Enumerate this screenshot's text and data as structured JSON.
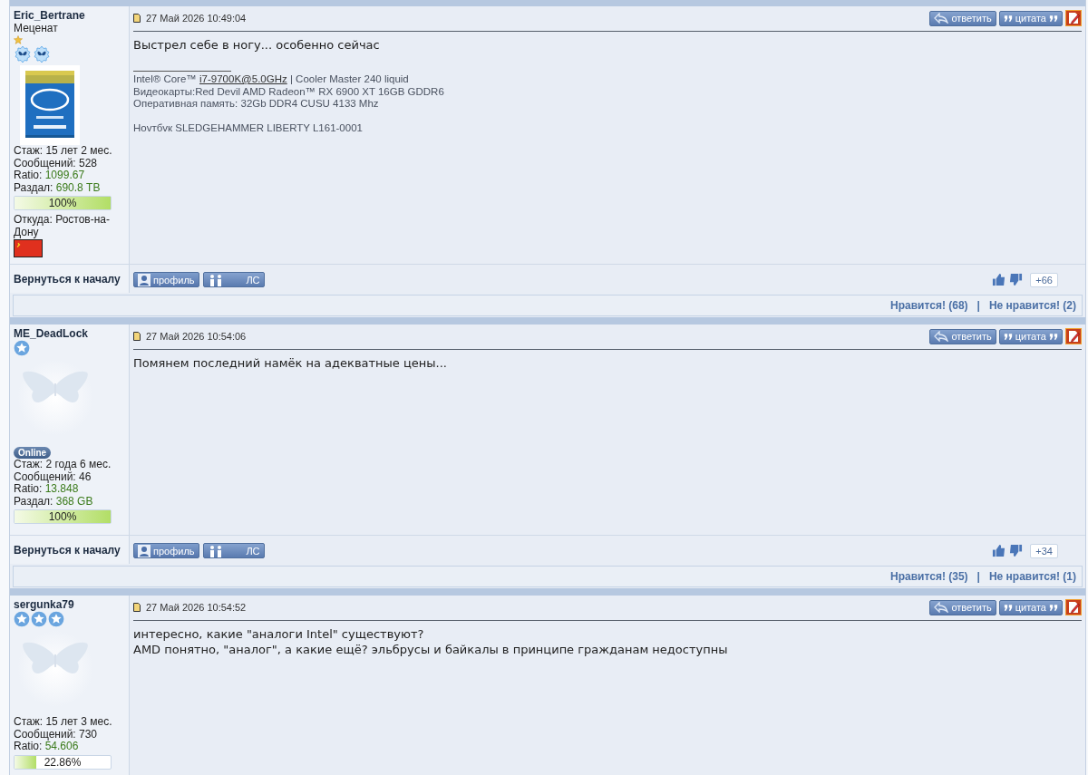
{
  "posts": [
    {
      "author": "Eric_Bertrane",
      "rank": "Меценат",
      "badges": [
        {
          "kind": "small-star"
        },
        {
          "kind": "butterfly"
        },
        {
          "kind": "butterfly"
        }
      ],
      "avatar": {
        "kind": "chip"
      },
      "stats": [
        {
          "label": "Стаж:",
          "value": "15 лет 2 мес.",
          "kind": "plain"
        },
        {
          "label": "Сообщений:",
          "value": "528",
          "kind": "plain"
        },
        {
          "label": "Ratio:",
          "value": "1099.67",
          "kind": "green"
        },
        {
          "label": "Раздал:",
          "value": "690.8 TB",
          "kind": "green"
        }
      ],
      "progress": {
        "level": 1,
        "label": "100%"
      },
      "location": "Откуда: Ростов-на-Дону",
      "flag": {
        "kind": "red"
      },
      "date": "27 Май 2026 10:49:04",
      "reply": "ответить",
      "quote": "цитата",
      "lines": [
        "Выстрел себе в ногу... особенно сейчас"
      ],
      "signature": [
        {
          "text": "Intel® Core™ ",
          "link": "i7-9700K@5.0GHz",
          "after": " | Cooler Master 240 liquid"
        },
        {
          "text": "Видеокарты:Red Devil AMD Radeon™ RX 6900 XT 16GB GDDR6"
        },
        {
          "text": "Оперативная память: 32Gb DDR4 CUSU 4133 Mhz"
        },
        {
          "text": "Ноvтбvк SLEDGEHAMMER LIBERTY L161-0001",
          "gap": true
        }
      ],
      "back": "Вернуться к началу",
      "profile": "профиль",
      "pm": "ЛС",
      "rating": "+66",
      "likes": "Нравится! (68)",
      "separator": "|",
      "dislikes": "Не нравится! (2)"
    },
    {
      "author": "ME_DeadLock",
      "badges": [
        {
          "kind": "star"
        }
      ],
      "avatar": {
        "kind": "default"
      },
      "online_label": "Online",
      "stats": [
        {
          "label": "Стаж:",
          "value": "2 года 6 мес.",
          "kind": "plain"
        },
        {
          "label": "Сообщений:",
          "value": "46",
          "kind": "plain"
        },
        {
          "label": "Ratio:",
          "value": "13.848",
          "kind": "green"
        },
        {
          "label": "Раздал:",
          "value": "368 GB",
          "kind": "green"
        }
      ],
      "progress": {
        "level": 1,
        "label": "100%"
      },
      "date": "27 Май 2026 10:54:06",
      "reply": "ответить",
      "quote": "цитата",
      "lines": [
        "Помянем последний намёк на адекватные цены..."
      ],
      "back": "Вернуться к началу",
      "profile": "профиль",
      "pm": "ЛС",
      "rating": "+34",
      "likes": "Нравится! (35)",
      "separator": "|",
      "dislikes": "Не нравится! (1)"
    },
    {
      "author": "sergunka79",
      "badges": [
        {
          "kind": "star"
        },
        {
          "kind": "star"
        },
        {
          "kind": "star"
        }
      ],
      "avatar": {
        "kind": "default"
      },
      "stats": [
        {
          "label": "Стаж:",
          "value": "15 лет 3 мес.",
          "kind": "plain"
        },
        {
          "label": "Сообщений:",
          "value": "730",
          "kind": "plain"
        },
        {
          "label": "Ratio:",
          "value": "54.606",
          "kind": "green"
        }
      ],
      "progress": {
        "level": 0.23,
        "label": "22.86%"
      },
      "date": "27 Май 2026 10:54:52",
      "reply": "ответить",
      "quote": "цитата",
      "lines": [
        "интересно, какие \"аналоги Intel\" существуют?",
        "AMD понятно, \"аналог\", а какие ещё? эльбрусы и байкалы в принципе гражданам недоступны"
      ]
    }
  ]
}
